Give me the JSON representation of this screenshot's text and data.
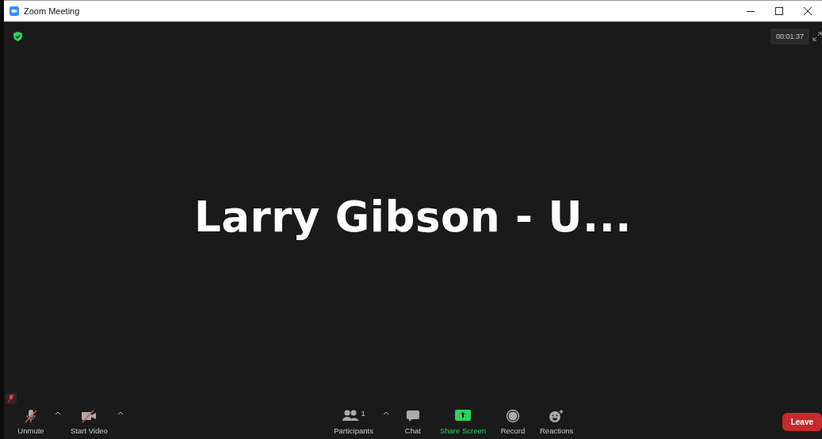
{
  "window": {
    "title": "Zoom Meeting"
  },
  "meeting": {
    "encrypted": true,
    "timer": "00:01:37",
    "speaker_name": "Larry Gibson - U...",
    "self_muted": true
  },
  "toolbar": {
    "left": [
      {
        "kind": "mic",
        "label": "Unmute",
        "slashed": true,
        "has_menu": true
      },
      {
        "kind": "video",
        "label": "Start Video",
        "slashed": true,
        "has_menu": true
      }
    ],
    "center": [
      {
        "kind": "participants",
        "label": "Participants",
        "count": "1",
        "has_menu": true
      },
      {
        "kind": "chat",
        "label": "Chat",
        "has_menu": false
      },
      {
        "kind": "share",
        "label": "Share Screen",
        "has_menu": false
      },
      {
        "kind": "record",
        "label": "Record",
        "has_menu": false
      },
      {
        "kind": "reactions",
        "label": "Reactions",
        "has_menu": false
      }
    ],
    "leave": "Leave"
  }
}
